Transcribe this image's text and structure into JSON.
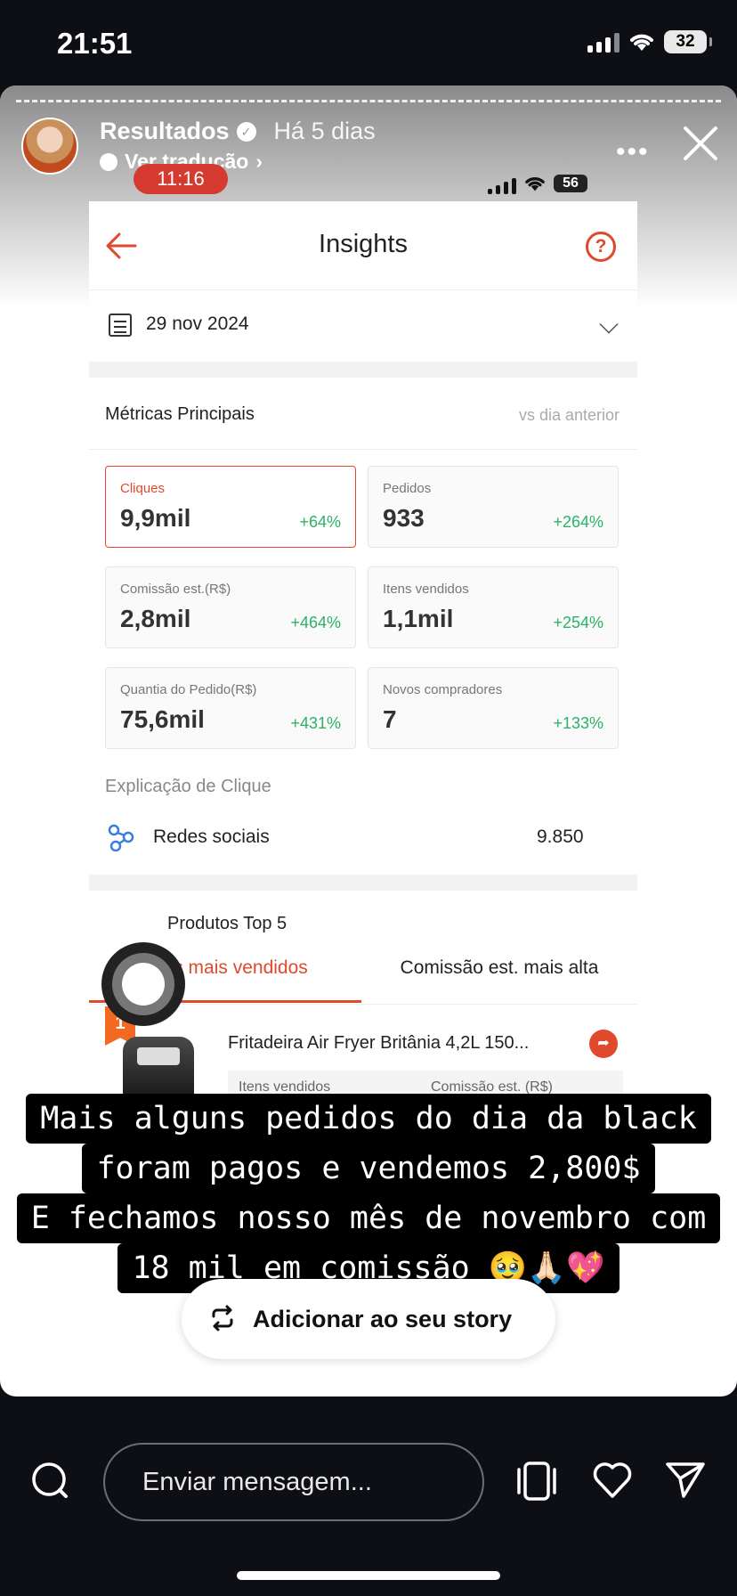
{
  "os": {
    "time": "21:51",
    "battery": "32"
  },
  "story": {
    "username": "Resultados",
    "time_ago": "Há 5 dias",
    "translate": "Ver tradução",
    "inner_time": "11:16",
    "inner_battery": "56"
  },
  "app": {
    "title": "Insights",
    "date": "29 nov 2024",
    "metrics_title": "Métricas Principais",
    "metrics_compare": "vs dia anterior",
    "metrics": [
      {
        "label": "Cliques",
        "value": "9,9mil",
        "delta": "+64%"
      },
      {
        "label": "Pedidos",
        "value": "933",
        "delta": "+264%"
      },
      {
        "label": "Comissão est.(R$)",
        "value": "2,8mil",
        "delta": "+464%"
      },
      {
        "label": "Itens vendidos",
        "value": "1,1mil",
        "delta": "+254%"
      },
      {
        "label": "Quantia do Pedido(R$)",
        "value": "75,6mil",
        "delta": "+431%"
      },
      {
        "label": "Novos compradores",
        "value": "7",
        "delta": "+133%"
      }
    ],
    "click_title": "Explicação de Clique",
    "click_source": "Redes sociais",
    "click_value": "9.850",
    "top_title": "Produtos Top 5",
    "tabs": [
      "Itens mais vendidos",
      "Comissão est. mais alta"
    ],
    "product": {
      "rank": "1",
      "name": "Fritadeira Air Fryer Britânia 4,2L 150...",
      "col1": "Itens vendidos",
      "col2": "Comissão est. (R$)"
    }
  },
  "caption": {
    "lines": [
      "Mais alguns pedidos do dia da black",
      "foram pagos e vendemos 2,800$",
      "E fechamos nosso mês de novembro com",
      "18 mil em comissão 🥹🙏🏻💖"
    ]
  },
  "add_story": "Adicionar ao seu story",
  "reply": {
    "placeholder": "Enviar mensagem..."
  },
  "colors": {
    "accent": "#e0492b",
    "positive": "#2bb267",
    "background": "#0d0f14"
  }
}
